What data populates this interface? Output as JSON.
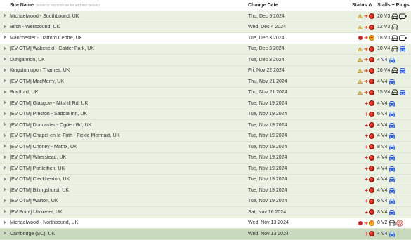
{
  "header": {
    "site_name": "Site Name",
    "site_name_hint": "(hover or expand row for address details)",
    "change_date": "Change Date",
    "status": "Status Δ",
    "stalls": "Stalls + Plugs"
  },
  "colors": {
    "row_green": "#eaf1e2",
    "row_white": "#ffffff",
    "row_selected": "#c9d9bd"
  },
  "rows": [
    {
      "name": "Michaelwood - Southbound, UK",
      "date": "Thu, Dec 5 2024",
      "status": "warn-to-closed",
      "stalls": "20 V3",
      "icons": [
        "car",
        "plug-ccs"
      ],
      "bg": "green"
    },
    {
      "name": "Birch - Westbound, UK",
      "date": "Wed, Dec 4 2024",
      "status": "warn-to-closed",
      "stalls": "12 V3",
      "icons": [
        "car"
      ],
      "bg": "green"
    },
    {
      "name": "Manchester - Trafford Centre, UK",
      "date": "Tue, Dec 3 2024",
      "status": "closed-to-open",
      "stalls": "18 V3",
      "icons": [
        "car",
        "plug-ccs"
      ],
      "bg": "white"
    },
    {
      "name": "[EV OTM] Wakefield - Calder Park, UK",
      "date": "Tue, Dec 3 2024",
      "status": "warn-to-closed",
      "stalls": "10 V4",
      "icons": [
        "car",
        "car-blue"
      ],
      "bg": "green"
    },
    {
      "name": "Dungannon, UK",
      "date": "Tue, Dec 3 2024",
      "status": "warn-to-closed",
      "stalls": "4 V4",
      "icons": [
        "car-blue"
      ],
      "bg": "green"
    },
    {
      "name": "Kingston upon Thames, UK",
      "date": "Fri, Nov 22 2024",
      "status": "warn-to-closed",
      "stalls": "16 V4",
      "icons": [
        "car",
        "car-blue"
      ],
      "bg": "green"
    },
    {
      "name": "[EV OTM] MacMerry, UK",
      "date": "Thu, Nov 21 2024",
      "status": "warn-to-closed",
      "stalls": "4 V4",
      "icons": [
        "car-blue"
      ],
      "bg": "green"
    },
    {
      "name": "Bradford, UK",
      "date": "Thu, Nov 21 2024",
      "status": "warn-to-closed",
      "stalls": "15 V4",
      "icons": [
        "car",
        "car-blue"
      ],
      "bg": "green"
    },
    {
      "name": "[EV OTM] Glasgow - Nitshill Rd, UK",
      "date": "Tue, Nov 19 2024",
      "status": "plus-closed",
      "stalls": "4 V4",
      "icons": [
        "car-blue"
      ],
      "bg": "green"
    },
    {
      "name": "[EV OTM] Preston - Saddle Inn, UK",
      "date": "Tue, Nov 19 2024",
      "status": "plus-closed",
      "stalls": "6 V4",
      "icons": [
        "car-blue"
      ],
      "bg": "green"
    },
    {
      "name": "[EV OTM] Doncaster - Ogden Rd, UK",
      "date": "Tue, Nov 19 2024",
      "status": "plus-closed",
      "stalls": "4 V4",
      "icons": [
        "car-blue"
      ],
      "bg": "green"
    },
    {
      "name": "[EV OTM] Chapel-en-le-Frith - Fickle Mermaid, UK",
      "date": "Tue, Nov 19 2024",
      "status": "plus-closed",
      "stalls": "4 V4",
      "icons": [
        "car-blue"
      ],
      "bg": "green"
    },
    {
      "name": "[EV OTM] Chorley - Matrix, UK",
      "date": "Tue, Nov 19 2024",
      "status": "plus-closed",
      "stalls": "8 V4",
      "icons": [
        "car-blue"
      ],
      "bg": "green"
    },
    {
      "name": "[EV OTM] Wherstead, UK",
      "date": "Tue, Nov 19 2024",
      "status": "plus-closed",
      "stalls": "4 V4",
      "icons": [
        "car-blue"
      ],
      "bg": "green"
    },
    {
      "name": "[EV OTM] Portlethen, UK",
      "date": "Tue, Nov 19 2024",
      "status": "plus-closed",
      "stalls": "4 V4",
      "icons": [
        "car-blue"
      ],
      "bg": "green"
    },
    {
      "name": "[EV OTM] Cleckheaton, UK",
      "date": "Tue, Nov 19 2024",
      "status": "plus-closed",
      "stalls": "4 V4",
      "icons": [
        "car-blue"
      ],
      "bg": "green"
    },
    {
      "name": "[EV OTM] Billingshurst, UK",
      "date": "Tue, Nov 19 2024",
      "status": "plus-closed",
      "stalls": "4 V4",
      "icons": [
        "car-blue"
      ],
      "bg": "green"
    },
    {
      "name": "[EV OTM] Warton, UK",
      "date": "Tue, Nov 19 2024",
      "status": "plus-closed",
      "stalls": "6 V4",
      "icons": [
        "car-blue"
      ],
      "bg": "green"
    },
    {
      "name": "[EV Point] Uttoxeter, UK",
      "date": "Sat, Nov 16 2024",
      "status": "plus-closed",
      "stalls": "8 V4",
      "icons": [
        "car-blue"
      ],
      "bg": "green"
    },
    {
      "name": "Michaelwood - Northbound, UK",
      "date": "Wed, Nov 13 2024",
      "status": "closed-to-open",
      "stalls": "8 V2",
      "icons": [
        "car",
        "plug-chademo"
      ],
      "bg": "white"
    },
    {
      "name": "Cambridge (SC), UK",
      "date": "Wed, Nov 13 2024",
      "status": "plus-closed",
      "stalls": "4 V4",
      "icons": [
        "car-blue"
      ],
      "bg": "selected"
    }
  ]
}
